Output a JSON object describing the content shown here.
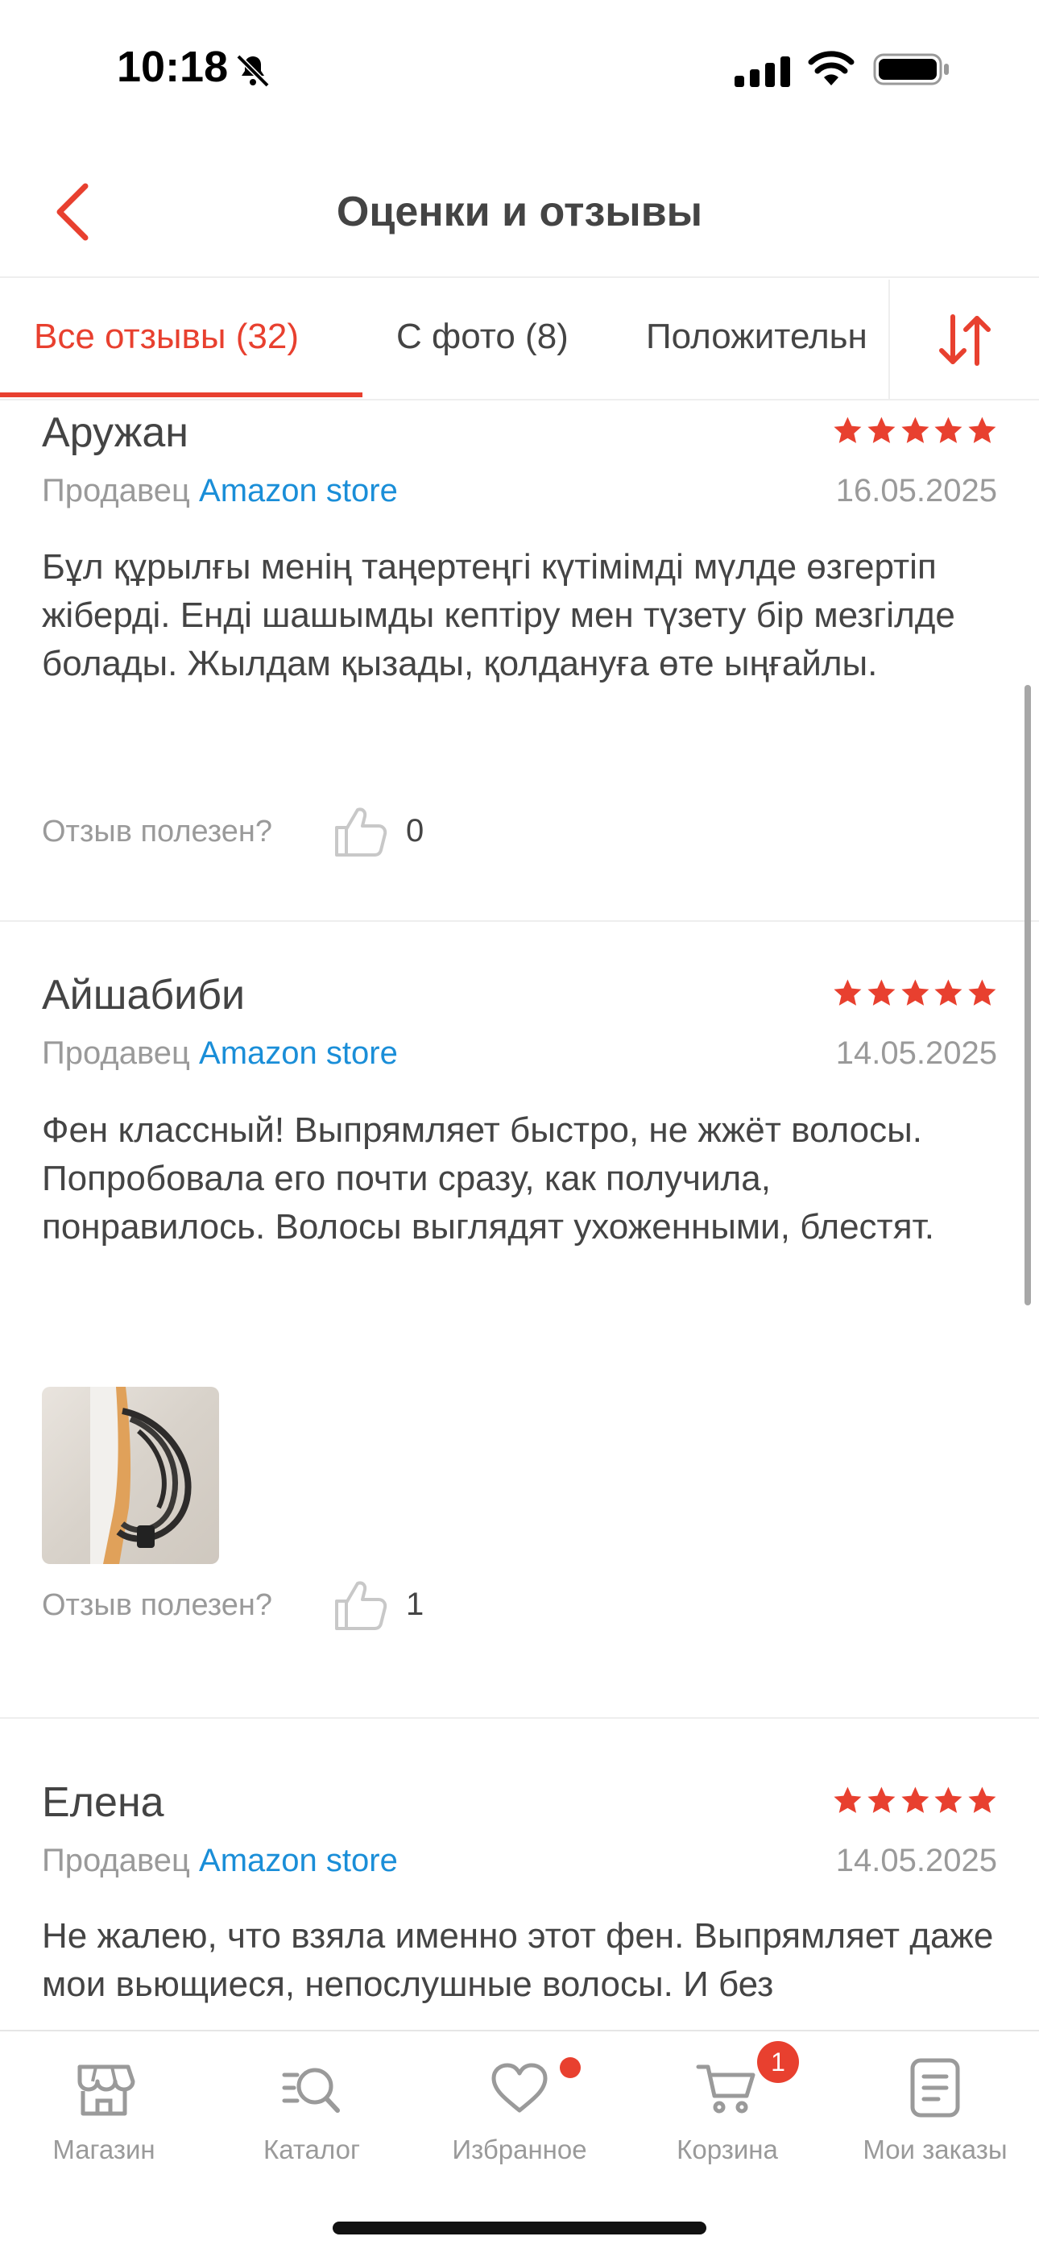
{
  "status_bar": {
    "time": "10:18"
  },
  "header": {
    "title": "Оценки и отзывы"
  },
  "tabs": [
    {
      "label": "Все отзывы (32)"
    },
    {
      "label": "С фото (8)"
    },
    {
      "label": "Положительн"
    }
  ],
  "reviews": [
    {
      "name": "Аружан",
      "rating": 5,
      "seller_prefix": "Продавец",
      "seller_name": "Amazon store",
      "date": "16.05.2025",
      "text": "Бұл құрылғы менің таңертеңгі күтімімді мүлде өзгертіп жіберді. Енді шашымды кептіру мен түзету бір мезгілде болады. Жылдам қызады, қолдануға өте ыңғайлы.",
      "helpful_label": "Отзыв полезен?",
      "helpful_count": "0"
    },
    {
      "name": "Айшабиби",
      "rating": 5,
      "seller_prefix": "Продавец",
      "seller_name": "Amazon store",
      "date": "14.05.2025",
      "text": "Фен классный! Выпрямляет быстро, не жжёт волосы. Попробовала его почти сразу, как получила, понравилось. Волосы выглядят ухоженными, блестят.",
      "helpful_label": "Отзыв полезен?",
      "helpful_count": "1"
    },
    {
      "name": "Елена",
      "rating": 5,
      "seller_prefix": "Продавец",
      "seller_name": "Amazon store",
      "date": "14.05.2025",
      "text": "Не жалею, что взяла именно этот фен. Выпрямляет даже мои вьющиеся, непослушные волосы. И без"
    }
  ],
  "bottom_nav": [
    {
      "label": "Магазин",
      "icon": "store-icon"
    },
    {
      "label": "Каталог",
      "icon": "catalog-search-icon"
    },
    {
      "label": "Избранное",
      "icon": "heart-icon"
    },
    {
      "label": "Корзина",
      "icon": "cart-icon",
      "badge": "1"
    },
    {
      "label": "Мои заказы",
      "icon": "orders-icon"
    }
  ],
  "colors": {
    "accent": "#e8402f",
    "link": "#1a8ed8",
    "muted": "#9a9a9a",
    "text": "#444444"
  }
}
